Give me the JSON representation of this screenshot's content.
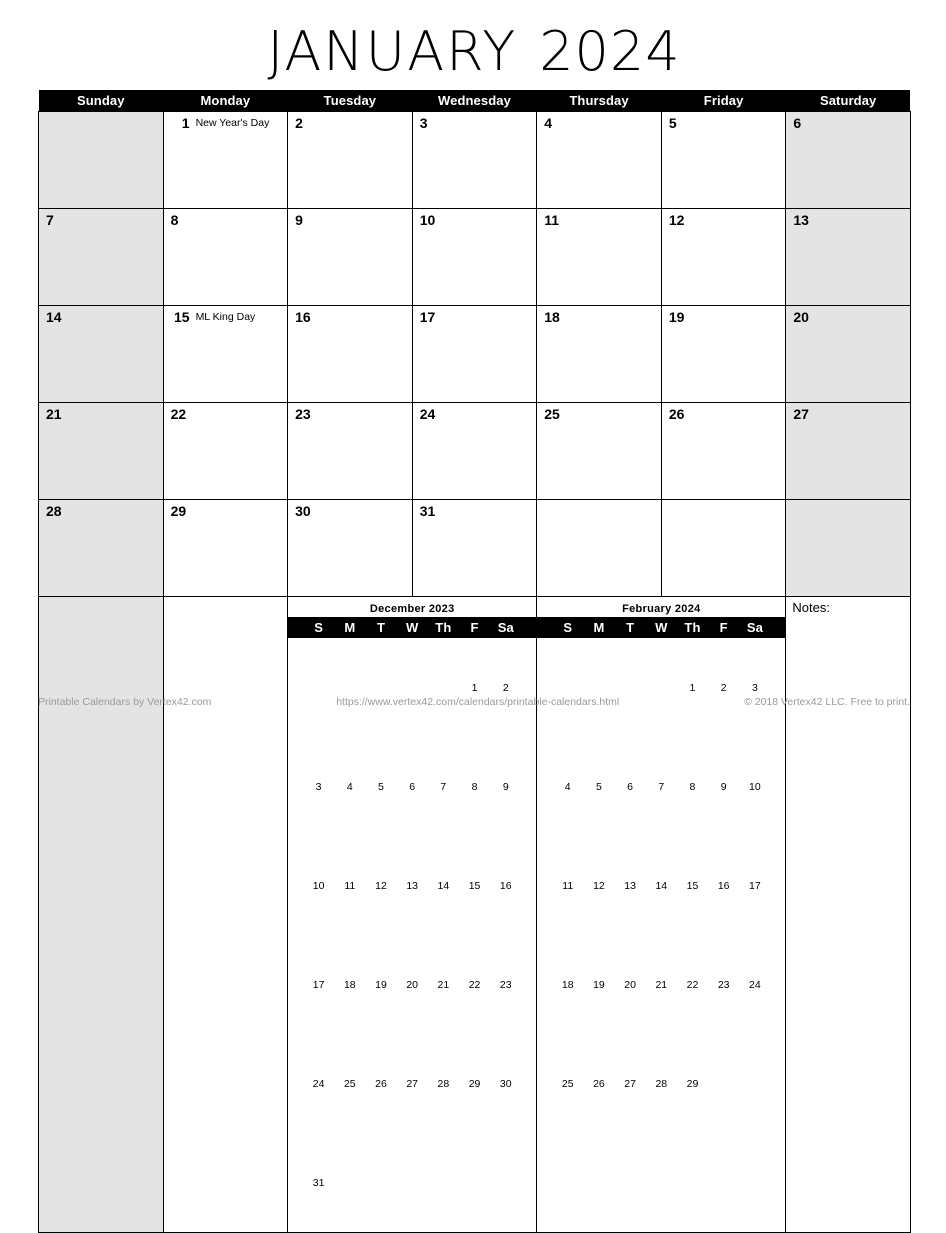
{
  "title": {
    "month": "JANUARY",
    "year": "2024"
  },
  "weekday_headers": [
    "Sunday",
    "Monday",
    "Tuesday",
    "Wednesday",
    "Thursday",
    "Friday",
    "Saturday"
  ],
  "weeks": [
    [
      {
        "day": "",
        "event": "",
        "weekend": true
      },
      {
        "day": "1",
        "event": "New Year's Day",
        "weekend": false
      },
      {
        "day": "2",
        "event": "",
        "weekend": false
      },
      {
        "day": "3",
        "event": "",
        "weekend": false
      },
      {
        "day": "4",
        "event": "",
        "weekend": false
      },
      {
        "day": "5",
        "event": "",
        "weekend": false
      },
      {
        "day": "6",
        "event": "",
        "weekend": true
      }
    ],
    [
      {
        "day": "7",
        "event": "",
        "weekend": true
      },
      {
        "day": "8",
        "event": "",
        "weekend": false
      },
      {
        "day": "9",
        "event": "",
        "weekend": false
      },
      {
        "day": "10",
        "event": "",
        "weekend": false
      },
      {
        "day": "11",
        "event": "",
        "weekend": false
      },
      {
        "day": "12",
        "event": "",
        "weekend": false
      },
      {
        "day": "13",
        "event": "",
        "weekend": true
      }
    ],
    [
      {
        "day": "14",
        "event": "",
        "weekend": true
      },
      {
        "day": "15",
        "event": "ML King Day",
        "weekend": false
      },
      {
        "day": "16",
        "event": "",
        "weekend": false
      },
      {
        "day": "17",
        "event": "",
        "weekend": false
      },
      {
        "day": "18",
        "event": "",
        "weekend": false
      },
      {
        "day": "19",
        "event": "",
        "weekend": false
      },
      {
        "day": "20",
        "event": "",
        "weekend": true
      }
    ],
    [
      {
        "day": "21",
        "event": "",
        "weekend": true
      },
      {
        "day": "22",
        "event": "",
        "weekend": false
      },
      {
        "day": "23",
        "event": "",
        "weekend": false
      },
      {
        "day": "24",
        "event": "",
        "weekend": false
      },
      {
        "day": "25",
        "event": "",
        "weekend": false
      },
      {
        "day": "26",
        "event": "",
        "weekend": false
      },
      {
        "day": "27",
        "event": "",
        "weekend": true
      }
    ],
    [
      {
        "day": "28",
        "event": "",
        "weekend": true
      },
      {
        "day": "29",
        "event": "",
        "weekend": false
      },
      {
        "day": "30",
        "event": "",
        "weekend": false
      },
      {
        "day": "31",
        "event": "",
        "weekend": false
      },
      {
        "day": "",
        "event": "",
        "weekend": false
      },
      {
        "day": "",
        "event": "",
        "weekend": false
      },
      {
        "day": "",
        "event": "",
        "weekend": true
      }
    ]
  ],
  "bottom_row": {
    "sunday_cell": {
      "weekend": true
    },
    "monday_cell": {
      "weekend": false
    },
    "notes_label": "Notes:"
  },
  "mini_calendars": [
    {
      "title": "December 2023",
      "headers": [
        "S",
        "M",
        "T",
        "W",
        "Th",
        "F",
        "Sa"
      ],
      "rows": [
        [
          "",
          "",
          "",
          "",
          "",
          "1",
          "2"
        ],
        [
          "3",
          "4",
          "5",
          "6",
          "7",
          "8",
          "9"
        ],
        [
          "10",
          "11",
          "12",
          "13",
          "14",
          "15",
          "16"
        ],
        [
          "17",
          "18",
          "19",
          "20",
          "21",
          "22",
          "23"
        ],
        [
          "24",
          "25",
          "26",
          "27",
          "28",
          "29",
          "30"
        ],
        [
          "31",
          "",
          "",
          "",
          "",
          "",
          ""
        ]
      ]
    },
    {
      "title": "February 2024",
      "headers": [
        "S",
        "M",
        "T",
        "W",
        "Th",
        "F",
        "Sa"
      ],
      "rows": [
        [
          "",
          "",
          "",
          "",
          "1",
          "2",
          "3"
        ],
        [
          "4",
          "5",
          "6",
          "7",
          "8",
          "9",
          "10"
        ],
        [
          "11",
          "12",
          "13",
          "14",
          "15",
          "16",
          "17"
        ],
        [
          "18",
          "19",
          "20",
          "21",
          "22",
          "23",
          "24"
        ],
        [
          "25",
          "26",
          "27",
          "28",
          "29",
          "",
          ""
        ]
      ]
    }
  ],
  "footer": {
    "left": "Printable Calendars by Vertex42.com",
    "center": "https://www.vertex42.com/calendars/printable-calendars.html",
    "right": "© 2018 Vertex42 LLC. Free to print."
  },
  "colors": {
    "header_bg": "#000000",
    "header_text": "#ffffff",
    "weekend_bg": "#e4e4e4",
    "border": "#000000",
    "footer_text": "#9a9a9a"
  }
}
